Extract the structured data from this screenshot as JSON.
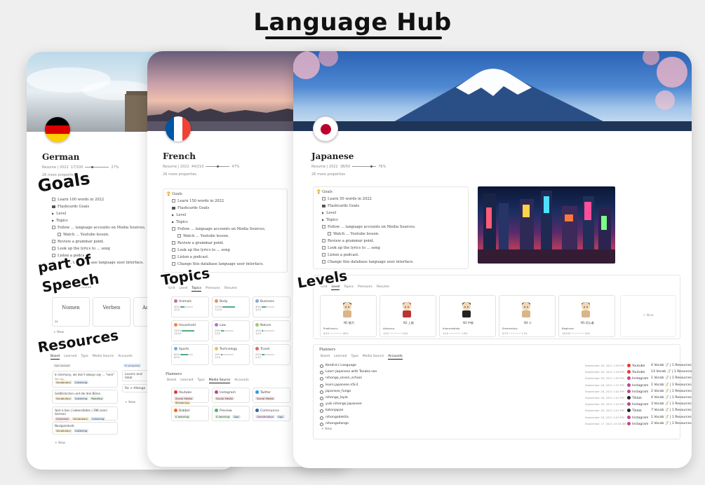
{
  "header": {
    "title": "Language Hub"
  },
  "overlays": {
    "goals": "Goals",
    "part_of_speech_1": "part of",
    "part_of_speech_2": "Speech",
    "resources": "Resources",
    "topics": "Topics",
    "levels": "Levels"
  },
  "german": {
    "title": "German",
    "progress_label": "Resume | 2022",
    "progress_count": "17/100",
    "progress_pct": "27%",
    "progress_value": 0.27,
    "more": "26 more properties",
    "goals": [
      "Learn 100 words in 2022",
      "Flashcards Goals",
      "Level",
      "Topics",
      "Follow ... language accounts on Media Sources.",
      "Watch ... Youtube lesson.",
      "Review a grammar point.",
      "Look up the lyrics to ... song",
      "Listen a podcast.",
      "Change this database language user interface."
    ],
    "pos_tabs": [
      "Topic",
      "Pronouns",
      "Resume"
    ],
    "pos_cards": [
      "Nomen",
      "Verben",
      "Ad"
    ],
    "pos_count": "24",
    "new_label": "+ New",
    "res_tabs": [
      "Board",
      "Learned",
      "Type",
      "Media Source",
      "Accounts"
    ],
    "res_col_a": "Not started",
    "res_col_b": "In progress",
    "res_items": [
      {
        "title": "In Germany, we don't always say ... \"nein\"",
        "sub": "We say...",
        "tags": [
          "Vocabulary",
          "Listening"
        ]
      },
      {
        "title": "Goldlöckchen und die drei Bären",
        "tags": [
          "Vocabulary",
          "Listening",
          "Reading"
        ]
      },
      {
        "title": "Yaxt is bon | Lebensfaden | 398 Learn German",
        "tags": [
          "Grammar",
          "Vocabulary",
          "Listening",
          "Listening"
        ]
      },
      {
        "title": "Navigoindustr.",
        "tags": [
          "Vocabulary",
          "Listening"
        ]
      }
    ],
    "res_right": [
      {
        "title": "Lovers and lokal"
      },
      {
        "title": "Rú + Allongo"
      }
    ]
  },
  "french": {
    "title": "French",
    "progress_label": "Resume | 2022",
    "progress_count": "44/210",
    "progress_pct": "47%",
    "progress_value": 0.47,
    "more": "26 more properties",
    "goals_heading": "Goals",
    "goals": [
      "Learn 150 words in 2022",
      "Flashcards Goals",
      "Level",
      "Topics",
      "Follow ... language accounts on Media Sources.",
      "Watch ... Youtube lesson.",
      "Review a grammar point.",
      "Look up the lyrics to ... song",
      "Listen a podcast.",
      "Change this database language user interface."
    ],
    "topic_tabs": [
      "Grid",
      "Level",
      "Topics",
      "Pronouns",
      "Resume"
    ],
    "topics": [
      {
        "name": "Animals",
        "pct": "30%",
        "n": "3/10"
      },
      {
        "name": "Body",
        "pct": "110%",
        "n": "11/10"
      },
      {
        "name": "Business",
        "pct": "30%",
        "n": "3/10"
      },
      {
        "name": "Household",
        "pct": "145%",
        "n": "14/10"
      },
      {
        "name": "Law",
        "pct": "20%",
        "n": "2/10"
      },
      {
        "name": "Nature",
        "pct": "10%",
        "n": "1/10"
      },
      {
        "name": "Sports",
        "pct": "60%",
        "n": "6/10"
      },
      {
        "name": "Technology",
        "pct": "10%",
        "n": "1/10"
      },
      {
        "name": "Travel",
        "pct": "20%",
        "n": "2/10"
      }
    ],
    "planner_heading": "Planners",
    "planner_tabs": [
      "Board",
      "Learned",
      "Type",
      "Media Source",
      "Accounts"
    ],
    "sources": [
      {
        "name": "Youtube",
        "tags": [
          "Social Media",
          "Streaming"
        ]
      },
      {
        "name": "Instagram",
        "tags": [
          "Social Media"
        ]
      },
      {
        "name": "Twitter",
        "tags": [
          "Social Media"
        ]
      },
      {
        "name": "Babbel",
        "tags": [
          "E-learning"
        ]
      },
      {
        "name": "Preview",
        "tags": [
          "E-learning",
          "App"
        ]
      },
      {
        "name": "Communico",
        "tags": [
          "Gamification",
          "App"
        ]
      }
    ]
  },
  "japanese": {
    "title": "Japanese",
    "progress_label": "Resume | 2022",
    "progress_count": "38/50",
    "progress_pct": "76%",
    "progress_value": 0.76,
    "more": "26 more properties",
    "goals_heading": "Goals",
    "goals": [
      "Learn 50 words in 2022",
      "Flashcards Goals",
      "Level",
      "Topics",
      "Follow ... language accounts on Media Sources.",
      "Watch ... Youtube lesson.",
      "Review a grammar point.",
      "Look up the lyrics to ... song",
      "Listen a podcast.",
      "Change this database language user interface."
    ],
    "level_tabs": [
      "Grid",
      "Level",
      "Topics",
      "Pronouns",
      "Resume"
    ],
    "levels": [
      {
        "badge": "N5 能力",
        "name": "Proficiency",
        "count": "4/10",
        "pct": "40%"
      },
      {
        "badge": "N2 上級",
        "name": "Advance",
        "count": "1/10",
        "pct": "14%"
      },
      {
        "badge": "N3 中級",
        "name": "Intermediate",
        "count": "1/10",
        "pct": "14%"
      },
      {
        "badge": "N4 小",
        "name": "Elementary",
        "count": "0/73",
        "pct": "11%"
      },
      {
        "badge": "N5 初心者",
        "name": "Beginner",
        "count": "14/100",
        "pct": "14%"
      }
    ],
    "planner_heading": "Planners",
    "planner_tabs": [
      "Board",
      "Learned",
      "Type",
      "Media Source",
      "Accounts"
    ],
    "accounts": [
      {
        "name": "Kendra's Language",
        "date": "September 28, 2021 1:08 PM",
        "platform": "Youtube",
        "vocab": "4 Vocab 📝 | 1 Resources",
        "color": "#e33"
      },
      {
        "name": "Learn Japanese with Tanaka san",
        "date": "September 28, 2021 1:28 PM",
        "platform": "Youtube",
        "vocab": "13 Vocab 📝 | 1 Resources",
        "color": "#e33"
      },
      {
        "name": "nihongo_onsen_school",
        "date": "September 28, 2021 1:30 PM",
        "platform": "Instagram",
        "vocab": "1 Vocab 📝 | 1 Resources",
        "color": "#c3448f"
      },
      {
        "name": "learn.japanese.n5n1",
        "date": "September 28, 2021 1:37 PM",
        "platform": "Instagram",
        "vocab": "1 Vocab 📝 | 1 Resources",
        "color": "#c3448f"
      },
      {
        "name": "japanese_fungo",
        "date": "September 28, 2021 1:40 PM",
        "platform": "Instagram",
        "vocab": "2 Vocab 📝 | 1 Resources",
        "color": "#c3448f"
      },
      {
        "name": "nihongo_layla",
        "date": "September 28, 2021 1:42 PM",
        "platform": "Tiktok",
        "vocab": "4 Vocab 📝 | 1 Resources",
        "color": "#222"
      },
      {
        "name": "yuki.nihongo.japanese",
        "date": "September 28, 2021 1:44 PM",
        "platform": "Instagram",
        "vocab": "3 Vocab 📝 | 1 Resources",
        "color": "#c3448f"
      },
      {
        "name": "kotonjapan",
        "date": "September 28, 2021 2:01 PM",
        "platform": "Tiktok",
        "vocab": "7 Vocab 📝 | 1 Resources",
        "color": "#222"
      },
      {
        "name": "nihongodekita",
        "date": "September 28, 2021 2:03 PM",
        "platform": "Instagram",
        "vocab": "1 Vocab 📝 | 1 Resources",
        "color": "#c3448f"
      },
      {
        "name": "nihongodango",
        "date": "September 17, 2021 10:16 AM",
        "platform": "Instagram",
        "vocab": "2 Vocab 📝 | 1 Resources",
        "color": "#c3448f"
      }
    ],
    "new_label": "+ New"
  }
}
